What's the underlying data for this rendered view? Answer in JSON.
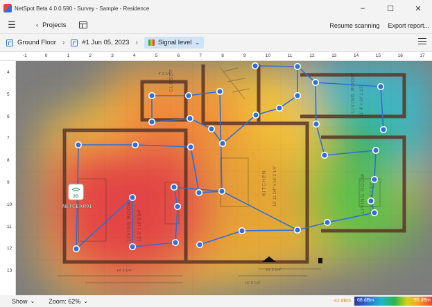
{
  "window": {
    "title": "NetSpot Beta 4.0.0.590 - Survey - Sample - Residence",
    "controls": [
      "–",
      "☐",
      "✕"
    ]
  },
  "toolbar": {
    "projects_label": "Projects",
    "resume_label": "Resume scanning",
    "export_label": "Export report..."
  },
  "breadcrumb": {
    "floor": "Ground Floor",
    "survey": "#1 Jun 05, 2023",
    "view": "Signal level"
  },
  "ruler": {
    "top_ticks": [
      "-1",
      "0",
      "1",
      "2",
      "3",
      "4",
      "5",
      "6",
      "7",
      "8",
      "9",
      "10",
      "11",
      "12",
      "13",
      "14",
      "15",
      "16",
      "17"
    ],
    "left_ticks": [
      "4",
      "5",
      "6",
      "7",
      "8",
      "9",
      "10",
      "11",
      "12",
      "13"
    ]
  },
  "map": {
    "access_point_band": "2G",
    "access_point_name": "NETGEAR01",
    "rooms": [
      "CLOSET",
      "LIVING ROOM",
      "KITCHEN",
      "LIVING ROOM",
      "LIVING ROOM"
    ],
    "room_dims": [
      "15' 5\" x 15' 6 3/4\"",
      "15' 11 1/4\" x 16' 2 1/4\"",
      "11' 4\" x 14' 1 1/2\"",
      "11' 4\" x 11' 2 3/4\""
    ],
    "dimensions": [
      "4' 3 1/4\"",
      "14' 2 1/4\"",
      "10' 2 1/4\"",
      "16' 8 1/4\""
    ]
  },
  "status": {
    "show_label": "Show",
    "zoom_label": "Zoom: 62%",
    "legend_min": "-42 dBm",
    "legend_mid": "68 dBm",
    "legend_max": "-95 dBm"
  },
  "colors": {
    "accent": "#2f6fd8",
    "route": "#2f6fd8",
    "selected_view_bg": "#cfe3f7"
  }
}
